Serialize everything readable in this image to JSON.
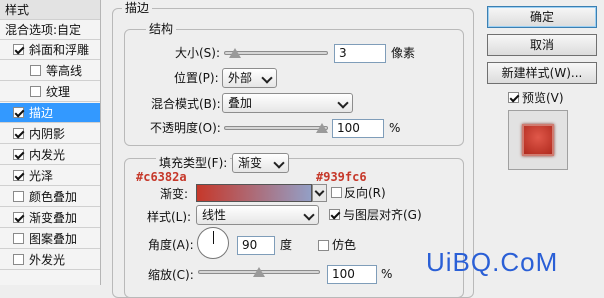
{
  "left_panel": {
    "header": "样式",
    "blend_options": "混合选项:自定",
    "items": [
      {
        "label": "斜面和浮雕",
        "checked": true,
        "indent": false,
        "selected": false
      },
      {
        "label": "等高线",
        "checked": false,
        "indent": true,
        "selected": false
      },
      {
        "label": "纹理",
        "checked": false,
        "indent": true,
        "selected": false
      },
      {
        "label": "描边",
        "checked": true,
        "indent": false,
        "selected": true
      },
      {
        "label": "内阴影",
        "checked": true,
        "indent": false,
        "selected": false
      },
      {
        "label": "内发光",
        "checked": true,
        "indent": false,
        "selected": false
      },
      {
        "label": "光泽",
        "checked": true,
        "indent": false,
        "selected": false
      },
      {
        "label": "颜色叠加",
        "checked": false,
        "indent": false,
        "selected": false
      },
      {
        "label": "渐变叠加",
        "checked": true,
        "indent": false,
        "selected": false
      },
      {
        "label": "图案叠加",
        "checked": false,
        "indent": false,
        "selected": false
      },
      {
        "label": "外发光",
        "checked": false,
        "indent": false,
        "selected": false
      }
    ]
  },
  "stroke": {
    "title": "描边",
    "structure_title": "结构",
    "size_label": "大小(S):",
    "size_value": "3",
    "size_unit": "像素",
    "size_level": 0.05,
    "position_label": "位置(P):",
    "position_value": "外部",
    "blend_label": "混合模式(B):",
    "blend_value": "叠加",
    "opacity_label": "不透明度(O):",
    "opacity_value": "100",
    "opacity_unit": "%",
    "opacity_level": 1.0,
    "fill_type_label": "填充类型(F):",
    "fill_type_value": "渐变",
    "gradient_left_hex": "#c6382a",
    "gradient_right_hex": "#939fc6",
    "gradient_label": "渐变:",
    "reverse_label": "反向(R)",
    "reverse_checked": false,
    "style_label": "样式(L):",
    "style_value": "线性",
    "align_label": "与图层对齐(G)",
    "align_checked": true,
    "angle_label": "角度(A):",
    "angle_value": "90",
    "angle_unit": "度",
    "dither_label": "仿色",
    "dither_checked": false,
    "scale_label": "缩放(C):",
    "scale_value": "100",
    "scale_unit": "%",
    "scale_level": 0.5
  },
  "buttons": {
    "ok": "确定",
    "cancel": "取消",
    "new_style": "新建样式(W)...",
    "preview": "预览(V)",
    "preview_checked": true
  },
  "watermark": "UiBQ.CoM",
  "colors": {
    "accent_red": "#c6382a",
    "accent_blue": "#939fc6",
    "selection": "#3399ff",
    "watermark": "#2a5fd6"
  }
}
